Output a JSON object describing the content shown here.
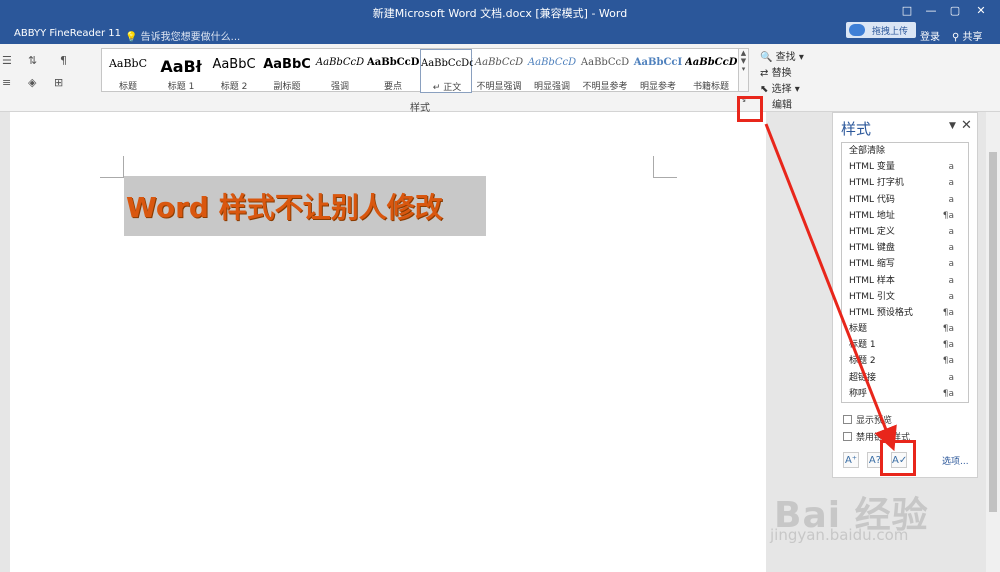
{
  "window": {
    "title": "新建Microsoft Word 文档.docx [兼容模式] - Word",
    "controls": [
      "□",
      "—",
      "▢",
      "✕"
    ]
  },
  "tabbar": {
    "abbyy": "ABBYY FineReader 11",
    "tellme": "告诉我您想要做什么...",
    "upload": "拖拽上传",
    "login": "登录",
    "share": "共享"
  },
  "ribbon": {
    "styles_group_label": "样式",
    "edit_group_label": "编辑",
    "launcher_icon": "↘",
    "style_gallery": [
      {
        "sample": "AaBbC",
        "name": "标题"
      },
      {
        "sample": "AaBł",
        "name": "标题 1"
      },
      {
        "sample": "AaBbC",
        "name": "标题 2"
      },
      {
        "sample": "AaBbC",
        "name": "副标题"
      },
      {
        "sample": "AaBbCcD",
        "name": "强调"
      },
      {
        "sample": "AaBbCcD",
        "name": "要点"
      },
      {
        "sample": "AaBbCcDd",
        "name": "↵ 正文"
      },
      {
        "sample": "AaBbCcD",
        "name": "不明显强调"
      },
      {
        "sample": "AaBbCcD",
        "name": "明显强调"
      },
      {
        "sample": "AaBbCcD",
        "name": "不明显参考"
      },
      {
        "sample": "AaBbCcI",
        "name": "明显参考"
      },
      {
        "sample": "AaBbCcD",
        "name": "书籍标题"
      }
    ],
    "edit": {
      "find": "查找",
      "replace": "替换",
      "select": "选择"
    }
  },
  "document": {
    "heading": "Word 样式不让别人修改"
  },
  "styles_pane": {
    "title": "样式",
    "items": [
      {
        "name": "全部清除",
        "type": ""
      },
      {
        "name": "HTML 变量",
        "type": "a"
      },
      {
        "name": "HTML 打字机",
        "type": "a"
      },
      {
        "name": "HTML 代码",
        "type": "a"
      },
      {
        "name": "HTML 地址",
        "type": "¶a"
      },
      {
        "name": "HTML 定义",
        "type": "a"
      },
      {
        "name": "HTML 键盘",
        "type": "a"
      },
      {
        "name": "HTML 缩写",
        "type": "a"
      },
      {
        "name": "HTML 样本",
        "type": "a"
      },
      {
        "name": "HTML 引文",
        "type": "a"
      },
      {
        "name": "HTML 预设格式",
        "type": "¶a"
      },
      {
        "name": "标题",
        "type": "¶a"
      },
      {
        "name": "标题 1",
        "type": "¶a"
      },
      {
        "name": "标题 2",
        "type": "¶a"
      },
      {
        "name": "超链接",
        "type": "a"
      },
      {
        "name": "称呼",
        "type": "¶a"
      }
    ],
    "show_preview": "显示预览",
    "disable_linked": "禁用链接样式",
    "options": "选项..."
  },
  "watermark": {
    "big": "Bai 经验",
    "small": "jingyan.baidu.com"
  },
  "colors": {
    "accent": "#2b579a",
    "highlight": "#e8261b",
    "heading_text": "#d9570f"
  }
}
